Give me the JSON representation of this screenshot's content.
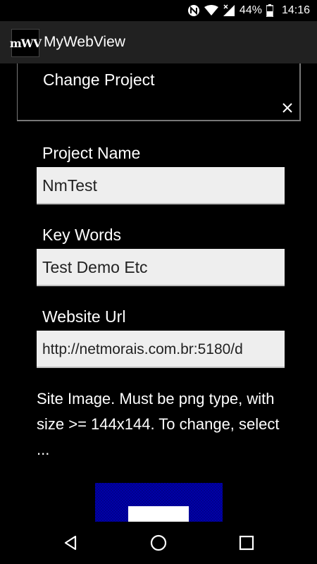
{
  "status_bar": {
    "battery": "44%",
    "time": "14:16",
    "icons": [
      "nfc-icon",
      "wifi-icon",
      "signal-icon",
      "battery-icon"
    ]
  },
  "app_bar": {
    "logo_text": "mWV",
    "title": "MyWebView"
  },
  "change_panel": {
    "title": "Change Project",
    "close_icon": "close-icon"
  },
  "form": {
    "project_name_label": "Project Name",
    "project_name_value": "NmTest",
    "key_words_label": "Key Words",
    "key_words_value": "Test Demo Etc",
    "website_url_label": "Website Url",
    "website_url_value": "http://netmorais.com.br:5180/d"
  },
  "site_image": {
    "description": " Site Image. Must be png type, with size >= 144x144. To change, select ..."
  },
  "nav_bar": {
    "icons": [
      "back-icon",
      "home-icon",
      "recents-icon"
    ]
  }
}
